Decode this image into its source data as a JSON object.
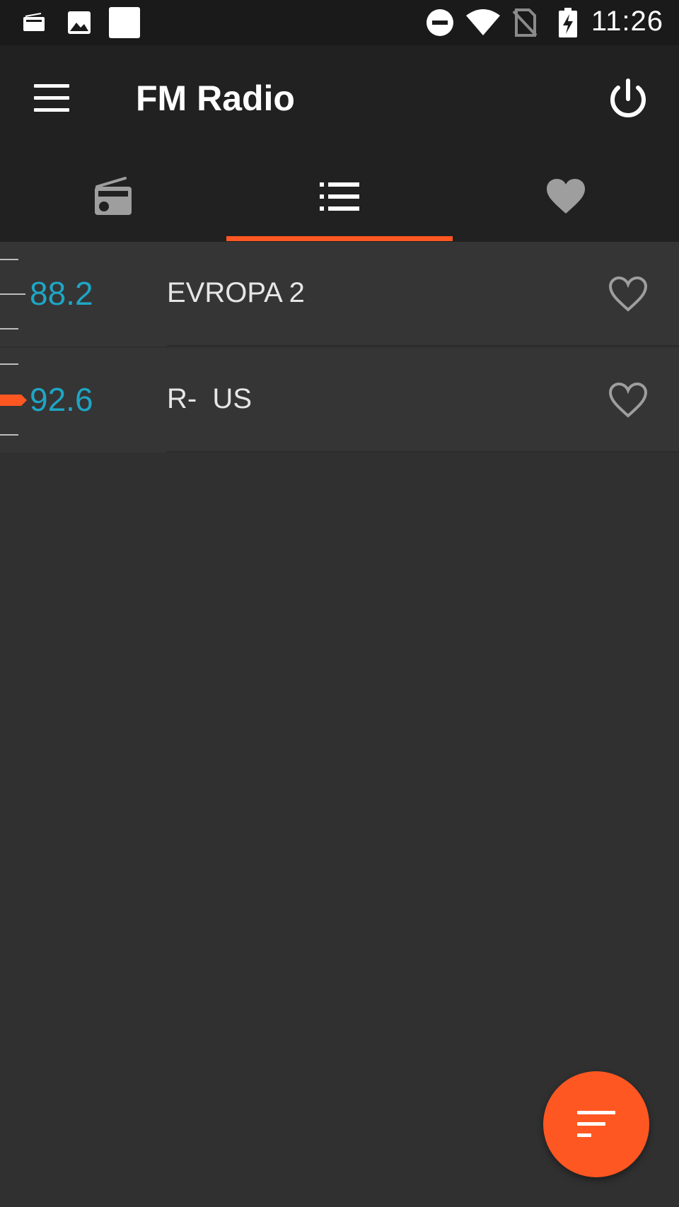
{
  "status_bar": {
    "time": "11:26",
    "icons": [
      "radio-icon",
      "image-icon",
      "square-icon",
      "do-not-disturb-icon",
      "wifi-icon",
      "no-sim-icon",
      "battery-charging-icon"
    ]
  },
  "app_bar": {
    "title": "FM Radio",
    "menu_icon": "hamburger-menu-icon",
    "power_icon": "power-icon"
  },
  "tabs": [
    {
      "icon": "radio-icon",
      "selected": false
    },
    {
      "icon": "list-icon",
      "selected": true
    },
    {
      "icon": "heart-icon",
      "selected": false
    }
  ],
  "stations": [
    {
      "frequency": "88.2",
      "name": "EVROPA 2",
      "favorite": false
    },
    {
      "frequency": "92.6",
      "name": "R-  US",
      "favorite": false
    }
  ],
  "fab": {
    "icon": "sort-icon"
  },
  "colors": {
    "accent": "#ff5722",
    "frequency": "#1ea6c5",
    "app_bar": "#212121",
    "background": "#303030"
  }
}
